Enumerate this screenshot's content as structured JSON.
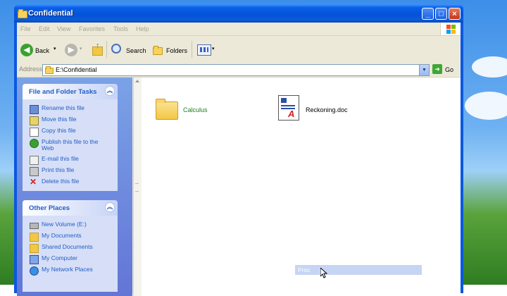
{
  "window": {
    "title": "Confidential"
  },
  "menu": [
    "File",
    "Edit",
    "View",
    "Favorites",
    "Tools",
    "Help"
  ],
  "toolbar": {
    "back_label": "Back",
    "search_label": "Search",
    "folders_label": "Folders"
  },
  "address": {
    "label": "Address",
    "value": "E:\\Confidential",
    "go_label": "Go"
  },
  "file_tasks": {
    "title": "File and Folder Tasks",
    "items": [
      {
        "label": "Rename this file",
        "icon": "rename-icon"
      },
      {
        "label": "Move this file",
        "icon": "move-icon"
      },
      {
        "label": "Copy this file",
        "icon": "copy-icon"
      },
      {
        "label": "Publish this file to the Web",
        "icon": "globe-icon"
      },
      {
        "label": "E-mail this file",
        "icon": "email-icon"
      },
      {
        "label": "Print this file",
        "icon": "printer-icon"
      },
      {
        "label": "Delete this file",
        "icon": "delete-icon"
      }
    ]
  },
  "other_places": {
    "title": "Other Places",
    "items": [
      {
        "label": "New Volume (E:)",
        "icon": "drive-icon"
      },
      {
        "label": "My Documents",
        "icon": "folder-icon"
      },
      {
        "label": "Shared Documents",
        "icon": "folder-icon"
      },
      {
        "label": "My Computer",
        "icon": "computer-icon"
      },
      {
        "label": "My Network Places",
        "icon": "network-icon"
      }
    ]
  },
  "files": [
    {
      "name": "Calculus",
      "type": "folder"
    },
    {
      "name": "Reckoning.doc",
      "type": "document"
    }
  ],
  "rename_box": {
    "text": "Proc"
  },
  "colors": {
    "title_blue": "#0453d8",
    "task_link": "#215dc6",
    "task_pane_bg": "#6375d6",
    "folder_label": "#1a7f1a"
  }
}
